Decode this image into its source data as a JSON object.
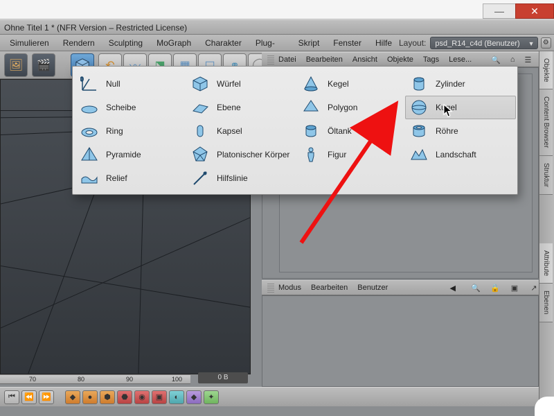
{
  "window": {
    "title": "Ohne Titel 1 * (NFR Version – Restricted License)"
  },
  "menus": {
    "items": [
      "Simulieren",
      "Rendern",
      "Sculpting",
      "MoGraph",
      "Charakter",
      "Plug-ins",
      "Skript",
      "Fenster",
      "Hilfe"
    ],
    "layout_label": "Layout:",
    "layout_value": "psd_R14_c4d (Benutzer)"
  },
  "obj_menu": {
    "items": [
      "Datei",
      "Bearbeiten",
      "Ansicht",
      "Objekte",
      "Tags",
      "Lese..."
    ]
  },
  "attr_menu": {
    "items": [
      "Modus",
      "Bearbeiten",
      "Benutzer"
    ]
  },
  "ruler": {
    "ticks": [
      "70",
      "80",
      "90",
      "100"
    ],
    "display": "0 B"
  },
  "sidetabs": [
    "Objekte",
    "Content Browser",
    "Struktur",
    "Attribute",
    "Ebenen"
  ],
  "flyout": {
    "cols": [
      [
        {
          "icon": "null",
          "label": "Null"
        },
        {
          "icon": "scheibe",
          "label": "Scheibe"
        },
        {
          "icon": "ring",
          "label": "Ring"
        },
        {
          "icon": "pyramide",
          "label": "Pyramide"
        },
        {
          "icon": "relief",
          "label": "Relief"
        }
      ],
      [
        {
          "icon": "wuerfel",
          "label": "Würfel"
        },
        {
          "icon": "ebene",
          "label": "Ebene"
        },
        {
          "icon": "kapsel",
          "label": "Kapsel"
        },
        {
          "icon": "platon",
          "label": "Platonischer Körper"
        },
        {
          "icon": "hilfslinie",
          "label": "Hilfslinie"
        }
      ],
      [
        {
          "icon": "kegel",
          "label": "Kegel"
        },
        {
          "icon": "polygon",
          "label": "Polygon"
        },
        {
          "icon": "oeltank",
          "label": "Öltank"
        },
        {
          "icon": "figur",
          "label": "Figur"
        }
      ],
      [
        {
          "icon": "zylinder",
          "label": "Zylinder"
        },
        {
          "icon": "kugel",
          "label": "Kugel",
          "hover": true
        },
        {
          "icon": "roehre",
          "label": "Röhre"
        },
        {
          "icon": "landschaft",
          "label": "Landschaft"
        }
      ]
    ]
  }
}
